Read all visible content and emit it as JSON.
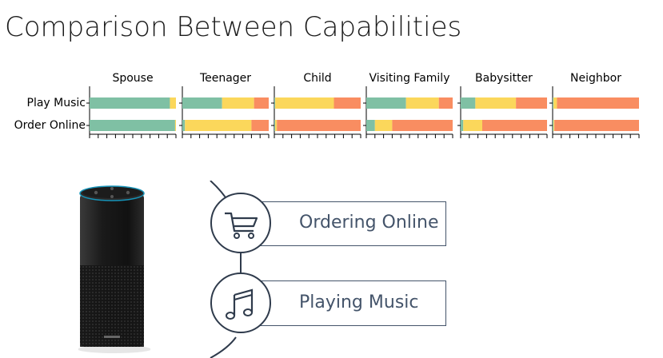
{
  "title": "Comparison Between Capabilities",
  "chart_data": {
    "type": "bar",
    "stacked": true,
    "orientation": "horizontal",
    "panels": [
      "Spouse",
      "Teenager",
      "Child",
      "Visiting Family",
      "Babysitter",
      "Neighbor"
    ],
    "categories": [
      "Play Music",
      "Order Online"
    ],
    "segment_colors": [
      "#7fc0a4",
      "#fbd75b",
      "#f98d61"
    ],
    "values": {
      "Spouse": {
        "Play Music": [
          0.93,
          0.07,
          0.0
        ],
        "Order Online": [
          0.99,
          0.01,
          0.0
        ]
      },
      "Teenager": {
        "Play Music": [
          0.46,
          0.37,
          0.17
        ],
        "Order Online": [
          0.03,
          0.77,
          0.2
        ]
      },
      "Child": {
        "Play Music": [
          0.01,
          0.68,
          0.31
        ],
        "Order Online": [
          0.01,
          0.02,
          0.97
        ]
      },
      "Visiting Family": {
        "Play Music": [
          0.46,
          0.38,
          0.16
        ],
        "Order Online": [
          0.1,
          0.2,
          0.7
        ]
      },
      "Babysitter": {
        "Play Music": [
          0.17,
          0.47,
          0.36
        ],
        "Order Online": [
          0.03,
          0.22,
          0.75
        ]
      },
      "Neighbor": {
        "Play Music": [
          0.01,
          0.04,
          0.95
        ],
        "Order Online": [
          0.01,
          0.01,
          0.98
        ]
      }
    },
    "xlim": [
      0,
      1
    ],
    "grid": false,
    "legend": false
  },
  "capabilities": [
    {
      "label": "Ordering Online",
      "icon": "shopping-cart-icon"
    },
    {
      "label": "Playing Music",
      "icon": "music-note-icon"
    }
  ],
  "device": {
    "icon": "smart-speaker-icon",
    "brand": "amazon"
  }
}
